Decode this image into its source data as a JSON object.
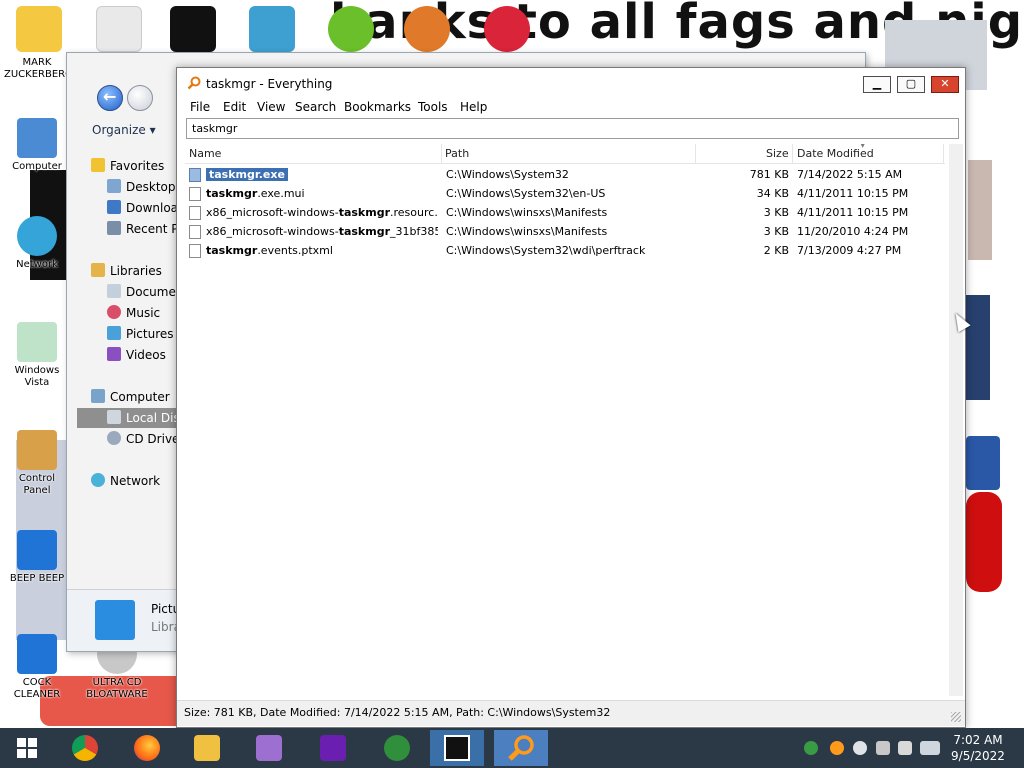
{
  "desktop": {
    "banner": "hanks to all fags and niggers",
    "icons": [
      {
        "label": "MARK ZUCKERBERG"
      },
      {
        "label": "Computer"
      },
      {
        "label": "Network"
      },
      {
        "label": "Windows Vista"
      },
      {
        "label": "Control Panel"
      },
      {
        "label": "BEEP BEEP"
      },
      {
        "label": "COCK CLEANER"
      },
      {
        "label": "ULTRA CD BLOATWARE"
      }
    ]
  },
  "explorer": {
    "organize": "Organize",
    "sidebar": [
      {
        "label": "Favorites",
        "icon": "star-icon"
      },
      {
        "label": "Desktop",
        "icon": "desktop-icon"
      },
      {
        "label": "Downloads",
        "icon": "download-icon"
      },
      {
        "label": "Recent Places",
        "icon": "recent-icon"
      },
      {
        "label": "Libraries",
        "icon": "library-icon"
      },
      {
        "label": "Documents",
        "icon": "documents-icon"
      },
      {
        "label": "Music",
        "icon": "music-icon"
      },
      {
        "label": "Pictures",
        "icon": "pictures-icon"
      },
      {
        "label": "Videos",
        "icon": "videos-icon"
      },
      {
        "label": "Computer",
        "icon": "computer-icon"
      },
      {
        "label": "Local Disk",
        "icon": "disk-icon"
      },
      {
        "label": "CD Drive",
        "icon": "cd-icon"
      },
      {
        "label": "Network",
        "icon": "network-icon"
      }
    ],
    "details": {
      "label": "Pictu",
      "sub": "Libra"
    }
  },
  "everything": {
    "title": "taskmgr - Everything",
    "menu": [
      "File",
      "Edit",
      "View",
      "Search",
      "Bookmarks",
      "Tools",
      "Help"
    ],
    "search_value": "taskmgr",
    "columns": {
      "name": "Name",
      "path": "Path",
      "size": "Size",
      "date": "Date Modified"
    },
    "rows": [
      {
        "name_pre": "",
        "name_bold": "taskmgr.exe",
        "name_post": "",
        "path": "C:\\Windows\\System32",
        "size": "781 KB",
        "date": "7/14/2022 5:15 AM"
      },
      {
        "name_pre": "",
        "name_bold": "taskmgr",
        "name_post": ".exe.mui",
        "path": "C:\\Windows\\System32\\en-US",
        "size": "34 KB",
        "date": "4/11/2011 10:15 PM"
      },
      {
        "name_pre": "x86_microsoft-windows-",
        "name_bold": "taskmgr",
        "name_post": ".resourc...",
        "path": "C:\\Windows\\winsxs\\Manifests",
        "size": "3 KB",
        "date": "4/11/2011 10:15 PM"
      },
      {
        "name_pre": "x86_microsoft-windows-",
        "name_bold": "taskmgr",
        "name_post": "_31bf385...",
        "path": "C:\\Windows\\winsxs\\Manifests",
        "size": "3 KB",
        "date": "11/20/2010 4:24 PM"
      },
      {
        "name_pre": "",
        "name_bold": "taskmgr",
        "name_post": ".events.ptxml",
        "path": "C:\\Windows\\System32\\wdi\\perftrack",
        "size": "2 KB",
        "date": "7/13/2009 4:27 PM"
      }
    ],
    "status": "Size: 781 KB, Date Modified: 7/14/2022 5:15 AM, Path: C:\\Windows\\System32"
  },
  "taskbar": {
    "apps": [
      "start-icon",
      "chrome-icon",
      "firefox-icon",
      "file-explorer-icon",
      "paint-icon",
      "yahoo-messenger-icon",
      "internet-download-icon",
      "7zip-icon",
      "everything-search-icon"
    ],
    "clock_time": "7:02 AM",
    "clock_date": "9/5/2022"
  },
  "colors": {
    "taskbar": "#2b3947",
    "selection": "#3d6fb3",
    "close": "#d8452f"
  }
}
